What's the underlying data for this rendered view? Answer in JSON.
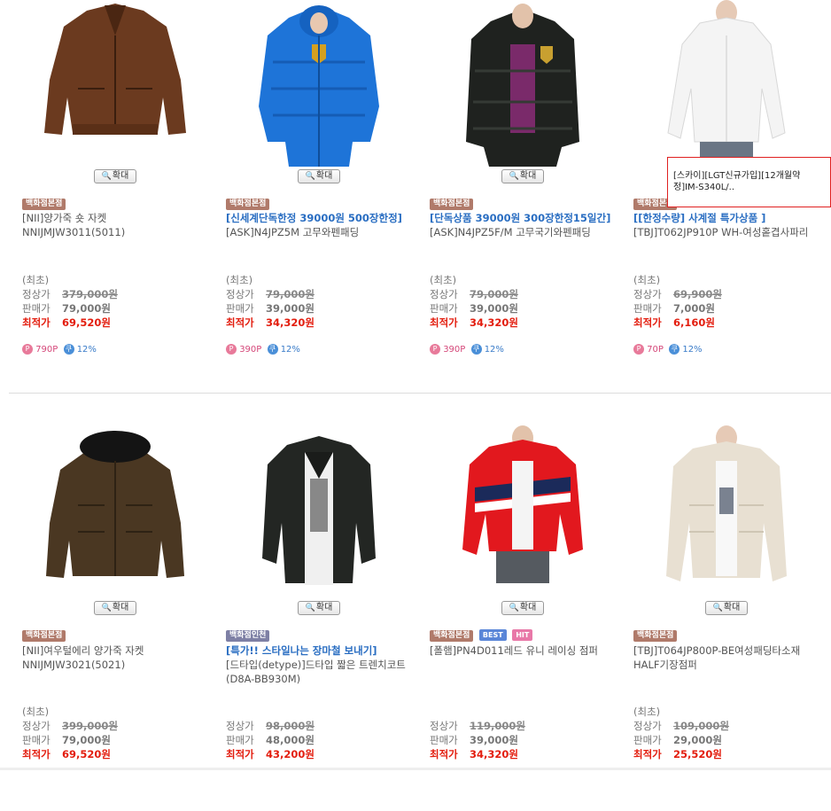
{
  "zoom_label": "확대",
  "products_row1": [
    {
      "badges": [
        {
          "text": "백화점본점",
          "kind": "store"
        }
      ],
      "promo": "",
      "name": "[NII]양가죽 숏 자켓 NNIJMJW3011(5011)",
      "min_label": "(최초)",
      "list_label": "정상가",
      "list_price": "379,000원",
      "sale_label": "판매가",
      "sale_price": "79,000원",
      "best_label": "최적가",
      "best_price": "69,520원",
      "points": "790P",
      "coupon": "12%"
    },
    {
      "badges": [
        {
          "text": "백화점본점",
          "kind": "store"
        }
      ],
      "promo": "[신세계단독한정 39000원 500장한정]",
      "name": "[ASK]N4JPZ5M 고무와펜패딩",
      "min_label": "(최초)",
      "list_label": "정상가",
      "list_price": "79,000원",
      "sale_label": "판매가",
      "sale_price": "39,000원",
      "best_label": "최적가",
      "best_price": "34,320원",
      "points": "390P",
      "coupon": "12%"
    },
    {
      "badges": [
        {
          "text": "백화점본점",
          "kind": "store"
        }
      ],
      "promo": "[단독상품 39000원 300장한정15일간]",
      "name": "[ASK]N4JPZ5F/M 고무국기와펜패딩",
      "min_label": "(최초)",
      "list_label": "정상가",
      "list_price": "79,000원",
      "sale_label": "판매가",
      "sale_price": "39,000원",
      "best_label": "최적가",
      "best_price": "34,320원",
      "points": "390P",
      "coupon": "12%"
    },
    {
      "badges": [
        {
          "text": "백화점본점",
          "kind": "store"
        }
      ],
      "promo": "[[한정수량] 사계절 특가상품 ]",
      "name": "[TBJ]T062JP910P WH-여성홑겹사파리",
      "min_label": "(최초)",
      "list_label": "정상가",
      "list_price": "69,900원",
      "sale_label": "판매가",
      "sale_price": "7,000원",
      "best_label": "최적가",
      "best_price": "6,160원",
      "points": "70P",
      "coupon": "12%"
    }
  ],
  "products_row2": [
    {
      "badges": [
        {
          "text": "백화점본점",
          "kind": "store"
        }
      ],
      "promo": "",
      "name": "[NII]여우털에리 양가죽 자켓 NNIJMJW3021(5021)",
      "min_label": "(최초)",
      "list_label": "정상가",
      "list_price": "399,000원",
      "sale_label": "판매가",
      "sale_price": "79,000원",
      "best_label": "최적가",
      "best_price": "69,520원"
    },
    {
      "badges": [
        {
          "text": "백화점인천",
          "kind": "incheon"
        }
      ],
      "promo": "[특가!! 스타일나는 장마철 보내기]",
      "name": "[드타입(detype)]드타입 짧은 트렌치코트(D8A-BB930M)",
      "min_label": "",
      "list_label": "정상가",
      "list_price": "98,000원",
      "sale_label": "판매가",
      "sale_price": "48,000원",
      "best_label": "최적가",
      "best_price": "43,200원"
    },
    {
      "badges": [
        {
          "text": "백화점본점",
          "kind": "store"
        },
        {
          "text": "BEST",
          "kind": "best"
        },
        {
          "text": "HIT",
          "kind": "hit"
        }
      ],
      "promo": "",
      "name": "[폴햄]PN4D011레드 유니 레이싱 점퍼",
      "min_label": "",
      "list_label": "정상가",
      "list_price": "119,000원",
      "sale_label": "판매가",
      "sale_price": "39,000원",
      "best_label": "최적가",
      "best_price": "34,320원"
    },
    {
      "badges": [
        {
          "text": "백화점본점",
          "kind": "store"
        }
      ],
      "promo": "",
      "name": "[TBJ]T064JP800P-BE여성패딩타소재HALF기장점퍼",
      "min_label": "(최초)",
      "list_label": "정상가",
      "list_price": "109,000원",
      "sale_label": "판매가",
      "sale_price": "29,000원",
      "best_label": "최적가",
      "best_price": "25,520원"
    }
  ],
  "tooltip": "[스카이][LGT신규가입][12개월약정]IM-S340L/..",
  "colors": {
    "best_price": "#e31d0e",
    "promo": "#2a6ec2",
    "store_badge": "#b07a6a"
  }
}
